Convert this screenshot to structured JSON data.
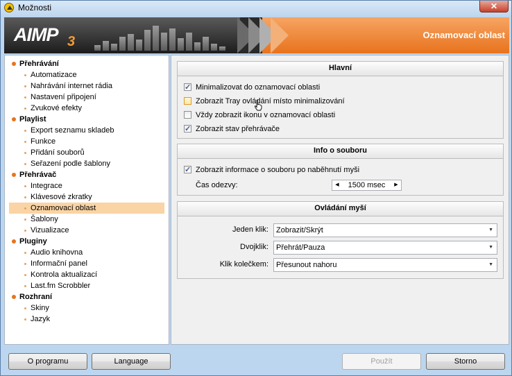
{
  "window": {
    "title": "Možnosti",
    "close_symbol": "✕"
  },
  "banner": {
    "logo": "AIMP",
    "logo_suffix": "3",
    "section_title": "Oznamovací oblast"
  },
  "tree": [
    {
      "label": "Přehrávání",
      "children": [
        "Automatizace",
        "Nahrávání internet rádia",
        "Nastavení připojení",
        "Zvukové efekty"
      ]
    },
    {
      "label": "Playlist",
      "children": [
        "Export seznamu skladeb",
        "Funkce",
        "Přidání souborů",
        "Seřazení podle šablony"
      ]
    },
    {
      "label": "Přehrávač",
      "children": [
        "Integrace",
        "Klávesové zkratky",
        "Oznamovací oblast",
        "Šablony",
        "Vizualizace"
      ]
    },
    {
      "label": "Pluginy",
      "children": [
        "Audio knihovna",
        "Informační panel",
        "Kontrola aktualizací",
        "Last.fm Scrobbler"
      ]
    },
    {
      "label": "Rozhraní",
      "children": [
        "Skiny",
        "Jazyk"
      ]
    }
  ],
  "selected_item": "Oznamovací oblast",
  "main_group": {
    "title": "Hlavní",
    "options": [
      {
        "label": "Minimalizovat do oznamovací oblasti",
        "checked": true
      },
      {
        "label": "Zobrazit Tray ovládání místo minimalizování",
        "checked": false
      },
      {
        "label": "Vždy zobrazit ikonu v oznamovací oblasti",
        "checked": false
      },
      {
        "label": "Zobrazit stav přehrávače",
        "checked": true
      }
    ]
  },
  "file_info_group": {
    "title": "Info o souboru",
    "show_info_label": "Zobrazit informace o souboru po naběhnutí myši",
    "show_info_checked": true,
    "delay_label": "Čas odezvy:",
    "delay_value": "1500 msec"
  },
  "mouse_group": {
    "title": "Ovládání myší",
    "rows": [
      {
        "label": "Jeden klik:",
        "value": "Zobrazit/Skrýt"
      },
      {
        "label": "Dvojklik:",
        "value": "Přehrát/Pauza"
      },
      {
        "label": "Klik kolečkem:",
        "value": "Přesunout nahoru"
      }
    ]
  },
  "buttons": {
    "about": "O programu",
    "language": "Language",
    "apply": "Použít",
    "cancel": "Storno"
  },
  "colors": {
    "accent_orange": "#e8731c",
    "selection": "#fad4a4",
    "window_frame": "#bcd6ef"
  }
}
